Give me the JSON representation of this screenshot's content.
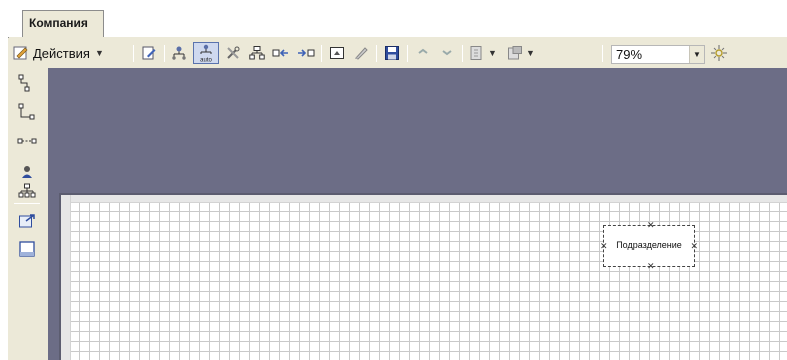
{
  "tabs": [
    {
      "label": "Компания",
      "active": true
    }
  ],
  "toolbar": {
    "actions_label": "Действия",
    "icons": [
      "edit-icon",
      "org-chart-icon",
      "auto-layout-icon",
      "tools-icon",
      "hierarchy-icon",
      "move-left-icon",
      "move-right-icon",
      "card-icon",
      "clear-icon",
      "save-icon",
      "arrow-up-icon",
      "arrow-down-icon",
      "import-icon",
      "export-icon",
      "zoom-fit-icon"
    ],
    "auto_button_label": "auto",
    "auto_button_active": true,
    "zoom": {
      "value": "79%"
    }
  },
  "palette": {
    "items": [
      "connector-elbow-icon",
      "connector-step-icon",
      "connector-straight-icon",
      "person-icon",
      "structure-icon",
      "export-image-icon",
      "page-frame-icon"
    ]
  },
  "canvas": {
    "background_color": "#6c6d86",
    "grid": true,
    "node": {
      "label": "Подразделение",
      "selected": true
    }
  }
}
